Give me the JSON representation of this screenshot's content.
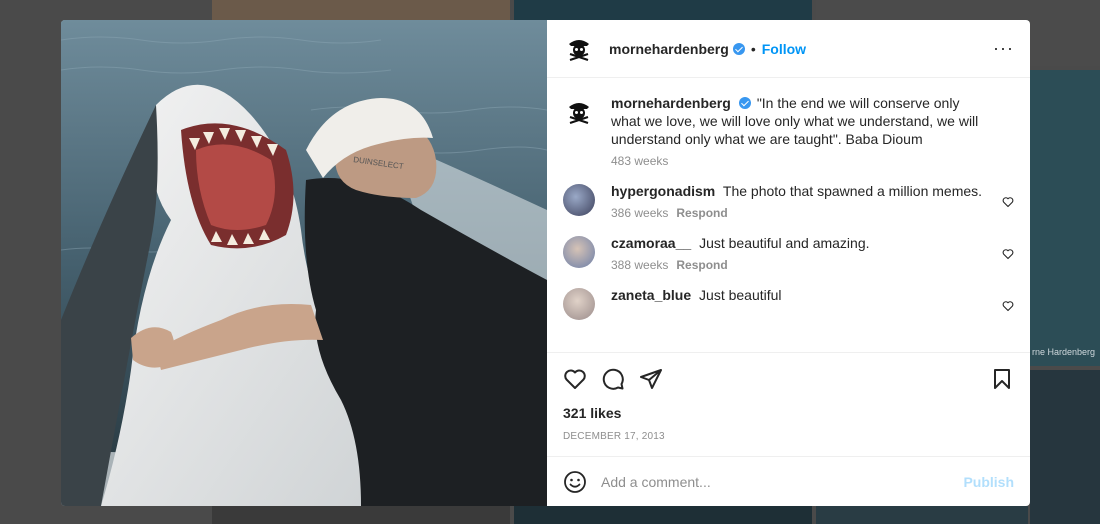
{
  "background": {
    "caption": "rne Hardenberg"
  },
  "post": {
    "author": "mornehardenberg",
    "follow_label": "Follow",
    "separator": "•",
    "more_label": "···",
    "caption": {
      "text": "\"In the end we will conserve only what we love, we will love only what we understand, we will understand only what we are taught\". Baba Dioum",
      "time": "483 weeks"
    },
    "comments": [
      {
        "user": "hypergonadism",
        "text": "The photo that spawned a million memes.",
        "time": "386 weeks",
        "respond": "Respond"
      },
      {
        "user": "czamoraa__",
        "text": "Just beautiful and amazing.",
        "time": "388 weeks",
        "respond": "Respond"
      },
      {
        "user": "zaneta_blue",
        "text": "Just beautiful",
        "time": "",
        "respond": ""
      }
    ],
    "likes": "321 likes",
    "date": "DECEMBER 17, 2013",
    "comment_placeholder": "Add a comment...",
    "publish_label": "Publish"
  },
  "colors": {
    "follow": "#0095f6",
    "verified": "#3897f0",
    "publish_disabled": "#b2dffc"
  },
  "icons": [
    "pirate-skull-icon",
    "verified-badge-icon",
    "more-options-icon",
    "heart-icon",
    "comment-icon",
    "share-icon",
    "bookmark-icon",
    "emoji-icon"
  ]
}
